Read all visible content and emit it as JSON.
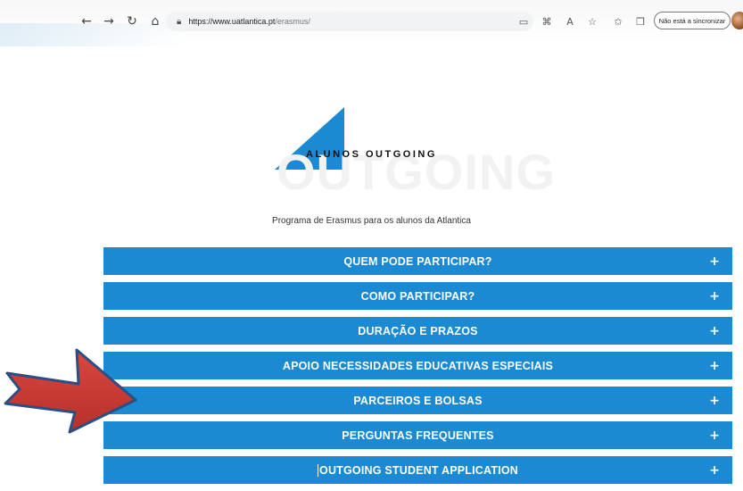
{
  "browser": {
    "back_icon": "←",
    "forward_icon": "→",
    "reload_icon": "↻",
    "home_icon": "⌂",
    "url_host": "https://www.uatlantica.pt",
    "url_path": "/erasmus/",
    "sync_label": "Não está a sincronizar"
  },
  "hero": {
    "title": "ALUNOS OUTGOING",
    "background_word": "OUTGOING",
    "subtitle": "Programa de Erasmus para os alunos da Atlantica",
    "accent_color": "#1b8ad3"
  },
  "accordion": {
    "items": [
      {
        "label": "QUEM PODE PARTICIPAR?",
        "toggle": "+"
      },
      {
        "label": "COMO PARTICIPAR?",
        "toggle": "+"
      },
      {
        "label": "DURAÇÃO E PRAZOS",
        "toggle": "+"
      },
      {
        "label": "APOIO NECESSIDADES EDUCATIVAS ESPECIAIS",
        "toggle": "+"
      },
      {
        "label": "PARCEIROS E BOLSAS",
        "toggle": "+"
      },
      {
        "label": "PERGUNTAS FREQUENTES",
        "toggle": "+"
      },
      {
        "label": "OUTGOING STUDENT APPLICATION",
        "toggle": "+"
      }
    ]
  }
}
